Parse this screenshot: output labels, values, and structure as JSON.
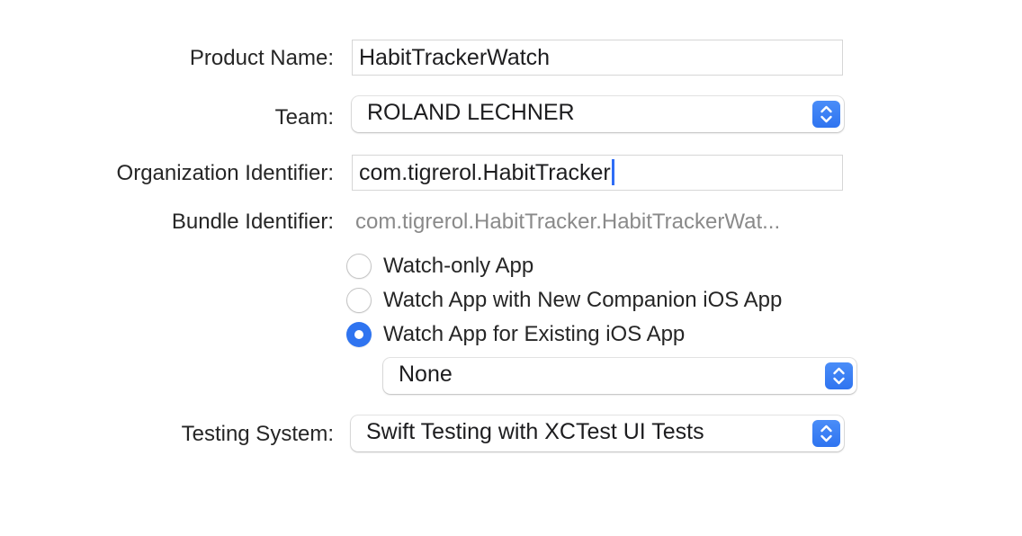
{
  "form": {
    "product_name": {
      "label": "Product Name:",
      "value": "HabitTrackerWatch"
    },
    "team": {
      "label": "Team:",
      "value": "ROLAND LECHNER"
    },
    "organization_identifier": {
      "label": "Organization Identifier:",
      "value": "com.tigrerol.HabitTracker"
    },
    "bundle_identifier": {
      "label": "Bundle Identifier:",
      "value": "com.tigrerol.HabitTracker.HabitTrackerWat..."
    },
    "app_type_options": [
      {
        "label": "Watch-only App",
        "selected": false
      },
      {
        "label": "Watch App with New Companion iOS App",
        "selected": false
      },
      {
        "label": "Watch App for Existing iOS App",
        "selected": true
      }
    ],
    "existing_ios_app": {
      "value": "None"
    },
    "testing_system": {
      "label": "Testing System:",
      "value": "Swift Testing with XCTest UI Tests"
    }
  },
  "colors": {
    "accent": "#2f74f0",
    "caret": "#2f6df6",
    "secondary_text": "#8a8a8a"
  },
  "icons": {
    "popup_stepper": "chevron-up-down-icon"
  }
}
